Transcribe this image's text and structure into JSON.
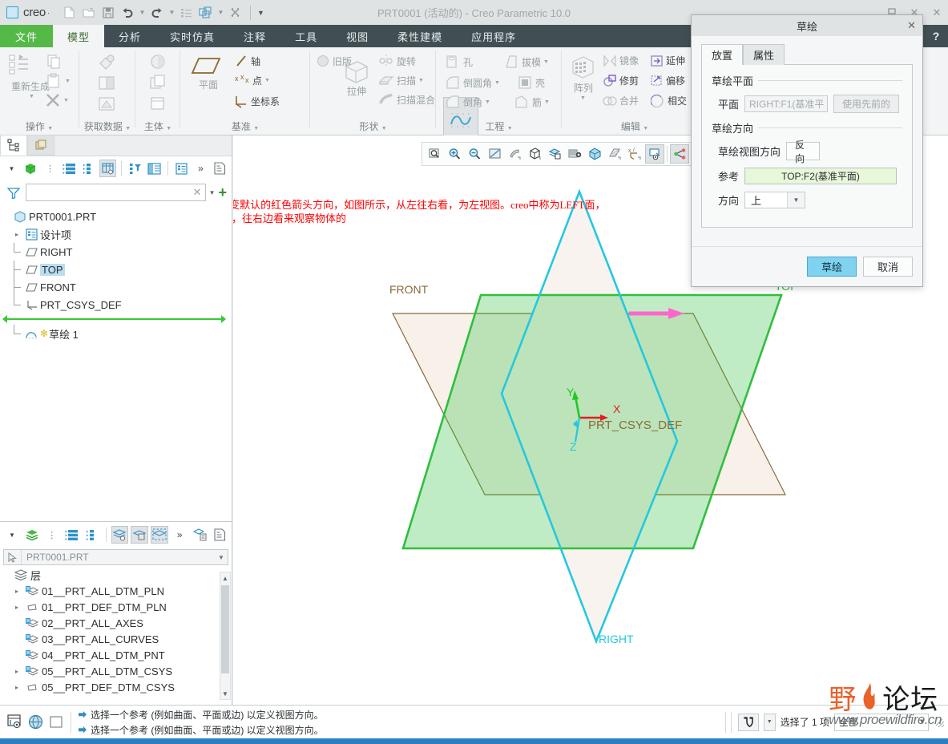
{
  "titlebar": {
    "brand": "creo",
    "brand_sup": "·",
    "title": "PRT0001 (活动的) - Creo Parametric 10.0",
    "qat": [
      {
        "name": "new-file-icon",
        "glyph": "⬜"
      },
      {
        "name": "open-file-icon",
        "glyph": "📂"
      },
      {
        "name": "save-icon",
        "glyph": "💾"
      },
      {
        "name": "undo-icon",
        "glyph": "↶"
      },
      {
        "name": "redo-icon",
        "glyph": "↷"
      },
      {
        "name": "regenerate-icon",
        "glyph": "≡"
      },
      {
        "name": "window-switch-icon",
        "glyph": "❐"
      },
      {
        "name": "close-window-icon",
        "glyph": "⌧"
      }
    ],
    "window_controls": [
      "–",
      "✕",
      "✕"
    ]
  },
  "ribbon": {
    "tabs": [
      {
        "label": "文件",
        "state": "file"
      },
      {
        "label": "模型",
        "state": "active"
      },
      {
        "label": "分析",
        "state": "normal"
      },
      {
        "label": "实时仿真",
        "state": "normal"
      },
      {
        "label": "注释",
        "state": "normal"
      },
      {
        "label": "工具",
        "state": "normal"
      },
      {
        "label": "视图",
        "state": "normal"
      },
      {
        "label": "柔性建模",
        "state": "normal"
      },
      {
        "label": "应用程序",
        "state": "normal"
      }
    ],
    "help_label": "?",
    "groups": [
      {
        "name": "操作",
        "label": "操作",
        "items": [
          {
            "label": "重新生成",
            "name": "regenerate-button"
          },
          {
            "label": "",
            "name": "copy-button"
          },
          {
            "label": "",
            "name": "paste-button"
          },
          {
            "label": "",
            "name": "delete-button"
          }
        ]
      },
      {
        "name": "获取数据",
        "label": "获取数据",
        "items": [
          {
            "label": "",
            "name": "import-button"
          },
          {
            "label": "",
            "name": "merge-inherit-button"
          },
          {
            "label": "",
            "name": "shrinkwrap-button"
          }
        ]
      },
      {
        "name": "主体",
        "label": "主体",
        "items": [
          {
            "label": "",
            "name": "body-options-button"
          },
          {
            "label": "",
            "name": "body-copy-button"
          },
          {
            "label": "",
            "name": "body-new-button"
          }
        ]
      },
      {
        "name": "基准",
        "label": "基准",
        "items": [
          {
            "label": "平面",
            "name": "datum-plane-button"
          },
          {
            "label": "轴",
            "name": "datum-axis-button"
          },
          {
            "label": "点",
            "name": "datum-point-button"
          },
          {
            "label": "坐标系",
            "name": "datum-csys-button"
          }
        ]
      },
      {
        "name": "形状",
        "label": "形状",
        "items": [
          {
            "label": "旧版",
            "name": "legacy-button"
          },
          {
            "label": "拉伸",
            "name": "extrude-button"
          },
          {
            "label": "旋转",
            "name": "revolve-button"
          },
          {
            "label": "扫描",
            "name": "sweep-button"
          },
          {
            "label": "扫描混合",
            "name": "swept-blend-button"
          }
        ]
      },
      {
        "name": "工程",
        "label": "工程",
        "items": [
          {
            "label": "孔",
            "name": "hole-button"
          },
          {
            "label": "拔模",
            "name": "draft-button"
          },
          {
            "label": "倒圆角",
            "name": "round-button"
          },
          {
            "label": "壳",
            "name": "shell-button"
          },
          {
            "label": "倒角",
            "name": "chamfer-button"
          },
          {
            "label": "筋",
            "name": "rib-button"
          }
        ]
      },
      {
        "name": "编辑",
        "label": "编辑",
        "items": [
          {
            "label": "阵列",
            "name": "pattern-button"
          },
          {
            "label": "镜像",
            "name": "mirror-button"
          },
          {
            "label": "延伸",
            "name": "extend-button"
          },
          {
            "label": "修剪",
            "name": "trim-button"
          },
          {
            "label": "偏移",
            "name": "offset-button"
          },
          {
            "label": "合并",
            "name": "merge-button"
          },
          {
            "label": "相交",
            "name": "intersect-button"
          }
        ]
      }
    ],
    "sketch_button": {
      "label": "草绘",
      "name": "sketch-button"
    }
  },
  "model_tree": {
    "tab_model": "model-tree-tab",
    "tab_detail": "detail-tree-tab",
    "filter_value": "",
    "filter_placeholder": "",
    "nodes": [
      {
        "label": "PRT0001.PRT",
        "icon": "part-icon",
        "indent": 0,
        "expander": "",
        "selected": false
      },
      {
        "label": "设计项",
        "icon": "design-items-icon",
        "indent": 1,
        "expander": "▸",
        "selected": false
      },
      {
        "label": "RIGHT",
        "icon": "datum-plane-icon",
        "indent": 1,
        "expander": "",
        "selected": false
      },
      {
        "label": "TOP",
        "icon": "datum-plane-icon",
        "indent": 1,
        "expander": "",
        "selected": true
      },
      {
        "label": "FRONT",
        "icon": "datum-plane-icon",
        "indent": 1,
        "expander": "",
        "selected": false
      },
      {
        "label": "PRT_CSYS_DEF",
        "icon": "csys-icon",
        "indent": 1,
        "expander": "",
        "selected": false
      },
      {
        "label": "草绘 1",
        "icon": "sketch-icon",
        "indent": 1,
        "expander": "",
        "selected": false,
        "asterisk": "✻"
      }
    ]
  },
  "layer_panel": {
    "combo_value": "PRT0001.PRT",
    "root_label": "层",
    "layers": [
      {
        "label": "01__PRT_ALL_DTM_PLN",
        "expander": "▸",
        "icon": "layer-icon"
      },
      {
        "label": "01__PRT_DEF_DTM_PLN",
        "expander": "▸",
        "icon": "plane-layer-icon"
      },
      {
        "label": "02__PRT_ALL_AXES",
        "expander": "",
        "icon": "layer-icon"
      },
      {
        "label": "03__PRT_ALL_CURVES",
        "expander": "",
        "icon": "layer-icon"
      },
      {
        "label": "04__PRT_ALL_DTM_PNT",
        "expander": "",
        "icon": "layer-icon"
      },
      {
        "label": "05__PRT_ALL_DTM_CSYS",
        "expander": "▸",
        "icon": "layer-icon"
      },
      {
        "label": "05__PRT_DEF_DTM_CSYS",
        "expander": "▸",
        "icon": "plane-layer-icon"
      }
    ]
  },
  "viewport": {
    "toolbar_icons": [
      {
        "name": "zoom-box-icon"
      },
      {
        "name": "zoom-in-icon"
      },
      {
        "name": "zoom-out-icon"
      },
      {
        "name": "refit-icon"
      },
      {
        "name": "repaint-icon"
      },
      {
        "name": "saved-orientation-icon"
      },
      {
        "name": "view-manager-icon"
      },
      {
        "name": "appearance-gallery-icon"
      },
      {
        "name": "perspective-view-icon"
      },
      {
        "name": "display-style-icon"
      },
      {
        "name": "datum-display-filters-icon"
      },
      {
        "name": "annotation-display-icon"
      },
      {
        "name": "spin-center-icon"
      }
    ],
    "annotation": "选择RIGHTD面，改变默认的红色箭头方向，如图所示，从左往右看，为左视图。creo中称为LEFT面，\n我们是站在物体左边，往右边看来观察物体的",
    "plane_labels": [
      {
        "text": "FRONT",
        "color": "#8a6a3a"
      },
      {
        "text": "TOP",
        "color": "#2fbf3f"
      },
      {
        "text": "RIGHT",
        "color": "#23c8e0"
      }
    ],
    "csys_label": "PRT_CSYS_DEF",
    "axis_labels": [
      {
        "text": "X",
        "color": "#e02020"
      },
      {
        "text": "Y",
        "color": "#23c823"
      },
      {
        "text": "Z",
        "color": "#23c8e0"
      }
    ],
    "colors": {
      "top_plane": "#2fbf3f",
      "right_plane": "#23c8e0",
      "front_plane": "#8a6a3a",
      "direction_arrow": "#ff66cc"
    }
  },
  "dialog": {
    "title": "草绘",
    "close_label": "✕",
    "tabs": [
      {
        "label": "放置",
        "active": true
      },
      {
        "label": "属性",
        "active": false
      }
    ],
    "section_plane": {
      "heading": "草绘平面",
      "plane_label": "平面",
      "plane_value": "RIGHT:F1(基准平",
      "use_previous_label": "使用先前的"
    },
    "section_orientation": {
      "heading": "草绘方向",
      "view_dir_label": "草绘视图方向",
      "flip_label": "反向",
      "reference_label": "参考",
      "reference_value": "TOP:F2(基准平面)",
      "direction_label": "方向",
      "direction_value": "上"
    },
    "ok_label": "草绘",
    "cancel_label": "取消"
  },
  "statusbar": {
    "messages": [
      "选择一个参考 (例如曲面、平面或边) 以定义视图方向。",
      "选择一个参考 (例如曲面、平面或边) 以定义视图方向。"
    ],
    "selection_count": "选择了 1 项",
    "filter_value": "全部",
    "icons": [
      {
        "name": "model-display-icon"
      },
      {
        "name": "globe-icon"
      },
      {
        "name": "blank-panel-icon"
      },
      {
        "name": "find-icon"
      }
    ]
  },
  "watermark": {
    "forum_name_1": "野",
    "forum_name_2": "论坛",
    "url": "www.proewildfire.cn"
  }
}
